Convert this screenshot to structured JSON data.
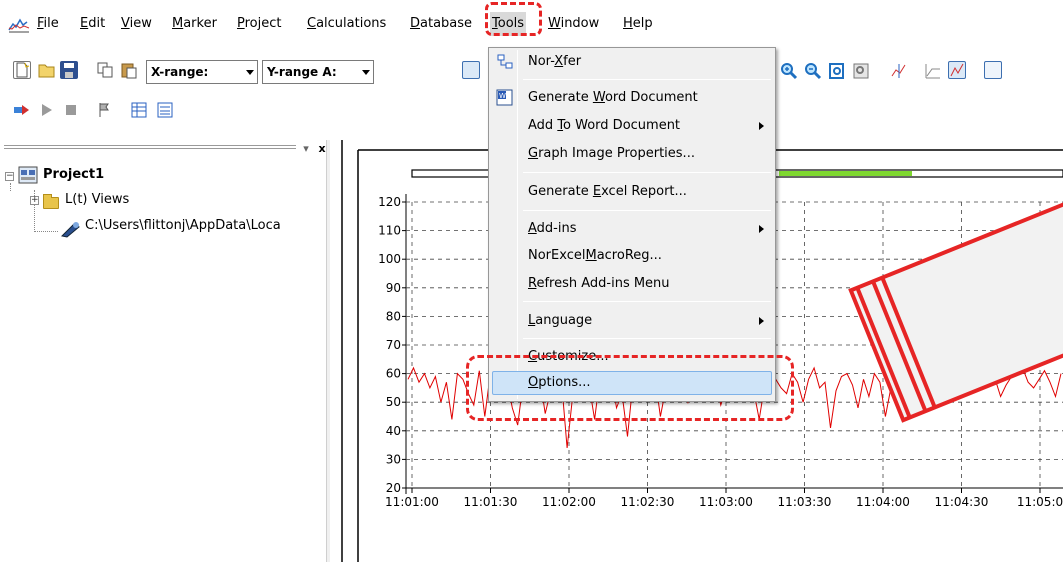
{
  "menubar": {
    "items": [
      "File",
      "Edit",
      "View",
      "Marker",
      "Project",
      "Calculations",
      "Database",
      "Tools",
      "Window",
      "Help"
    ]
  },
  "toolbar": {
    "x_range_label": "X-range:",
    "y_range_label": "Y-range A:"
  },
  "tree": {
    "root": "Project1",
    "views": "L(t) Views",
    "file_path": "C:\\Users\\flittonj\\AppData\\Loca",
    "close_glyph": "x"
  },
  "tools_menu": {
    "items": [
      {
        "label": "Nor-Xfer",
        "underline": "X"
      },
      {
        "label": "Generate Word Document",
        "underline": "W"
      },
      {
        "label": "Add To Word Document",
        "underline": "T",
        "submenu": true
      },
      {
        "label": "Graph Image Properties...",
        "underline": "G"
      },
      {
        "label": "Generate Excel Report...",
        "underline": "E"
      },
      {
        "label": "Add-ins",
        "underline": "A",
        "submenu": true
      },
      {
        "label": "NorExcelMacroReg...",
        "underline": "M"
      },
      {
        "label": "Refresh Add-ins Menu",
        "underline": "R"
      },
      {
        "label": "Language",
        "underline": "L",
        "submenu": true
      },
      {
        "label": "Customize...",
        "underline": "C"
      },
      {
        "label": "Options...",
        "underline": "O",
        "selected": true
      }
    ]
  },
  "chart_data": {
    "type": "line",
    "y_ticks": [
      "20",
      "30",
      "40",
      "50",
      "60",
      "70",
      "80",
      "90",
      "100",
      "110",
      "120"
    ],
    "x_ticks": [
      "11:01:00",
      "11:01:30",
      "11:02:00",
      "11:02:30",
      "11:03:00",
      "11:03:30",
      "11:04:00",
      "11:04:30",
      "11:05:0"
    ],
    "ylim": [
      20,
      120
    ],
    "grid": true,
    "series_color": "#e00000",
    "series": [
      {
        "values": [
          58,
          62,
          57,
          60,
          55,
          59,
          50,
          57,
          44,
          60,
          58,
          53,
          49,
          61,
          45,
          60,
          56,
          52,
          58,
          48,
          42,
          57,
          60,
          55,
          59,
          46,
          54,
          60,
          57,
          34,
          52,
          58,
          62,
          56,
          44,
          59,
          55,
          60,
          48,
          53,
          38,
          57,
          61,
          58,
          52,
          59,
          45,
          55,
          60,
          58,
          56,
          50,
          59,
          57,
          53,
          60,
          58,
          49,
          55,
          58,
          52,
          57,
          60,
          54,
          44,
          56,
          59,
          58,
          55,
          53,
          60,
          57,
          50,
          58,
          62,
          55,
          57,
          41,
          54,
          59,
          60,
          56,
          48,
          58,
          52,
          60,
          57,
          45,
          55,
          59,
          61,
          58,
          52,
          55,
          60,
          57,
          49,
          58,
          56,
          61,
          59,
          53,
          58,
          60,
          55,
          57,
          61,
          58,
          52,
          56,
          59,
          60,
          62,
          57,
          55,
          58,
          61,
          57,
          52,
          60
        ]
      }
    ],
    "slider_fill_color": "#7fd830"
  },
  "colors": {
    "highlight_red": "#e62525",
    "selected_bg": "#cfe4f8"
  }
}
